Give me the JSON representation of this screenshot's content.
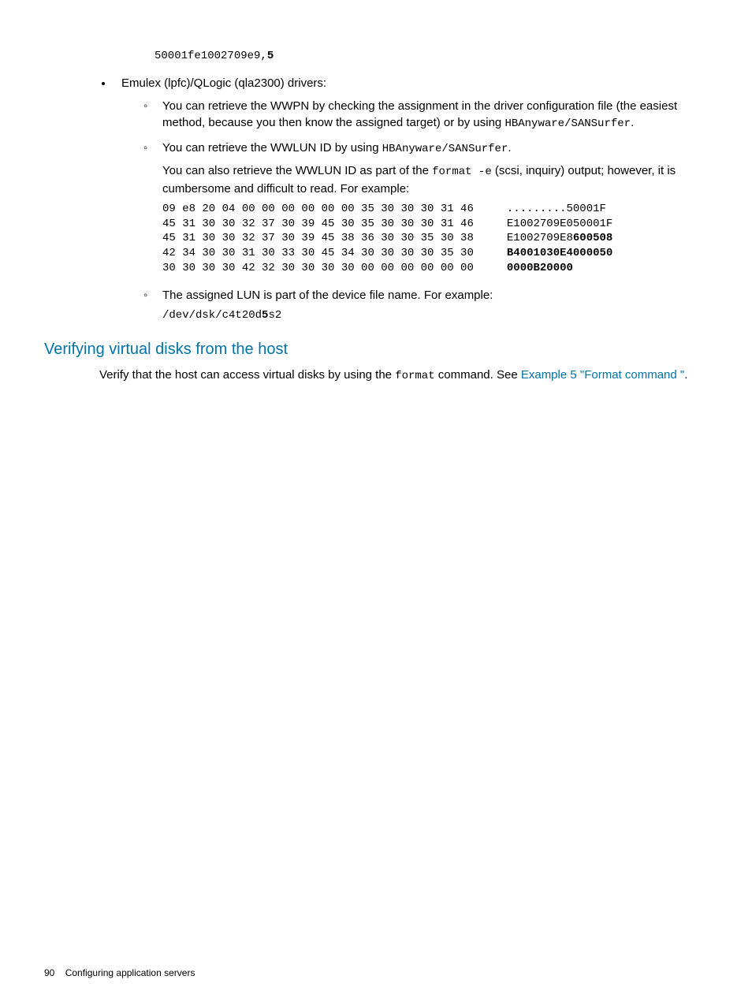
{
  "pre_code": {
    "prefix": "50001fe1002709e9,",
    "bold": "5"
  },
  "bullet1": {
    "text": "Emulex (lpfc)/QLogic (qla2300) drivers:"
  },
  "sub1": {
    "line1": "You can retrieve the WWPN by checking the assignment in the driver configuration file (the easiest method, because you then know the assigned target) or by using ",
    "code1": "HBAnyware/SANSurfer",
    "line1_end": "."
  },
  "sub2": {
    "line1": "You can retrieve the WWLUN ID by using ",
    "code1": "HBAnyware/SANSurfer",
    "line1_end": ".",
    "line2a": "You can also retrieve the WWLUN ID as part of the ",
    "code2": "format -e",
    "line2b": " (scsi, inquiry) output; however, it is cumbersome and difficult to read. For example:"
  },
  "hexblock": {
    "l1_left": "09 e8 20 04 00 00 00 00 00 00 35 30 30 30 31 46",
    "l1_right": ".........50001F",
    "l2_left": "45 31 30 30 32 37 30 39 45 30 35 30 30 30 31 46",
    "l2_right": "E1002709E050001F",
    "l3_left": "45 31 30 30 32 37 30 39 45 38 36 30 30 35 30 38",
    "l3_right_a": "E1002709E8",
    "l3_right_b": "600508",
    "l4_left": "42 34 30 30 31 30 33 30 45 34 30 30 30 30 35 30",
    "l4_right": "B4001030E4000050",
    "l5_left": "30 30 30 30 42 32 30 30 30 30 00 00 00 00 00 00",
    "l5_right": "0000B20000"
  },
  "sub3": {
    "text": "The assigned LUN is part of the device file name. For example:",
    "code_a": "/dev/dsk/c4t20d",
    "code_b": "5",
    "code_c": "s2"
  },
  "heading": "Verifying virtual disks from the host",
  "para": {
    "a": "Verify that the host can access virtual disks by using the ",
    "code": "format",
    "b": " command. See ",
    "link": "Example 5 \"Format command \"",
    "c": "."
  },
  "footer": {
    "page": "90",
    "chapter": "Configuring application servers"
  }
}
